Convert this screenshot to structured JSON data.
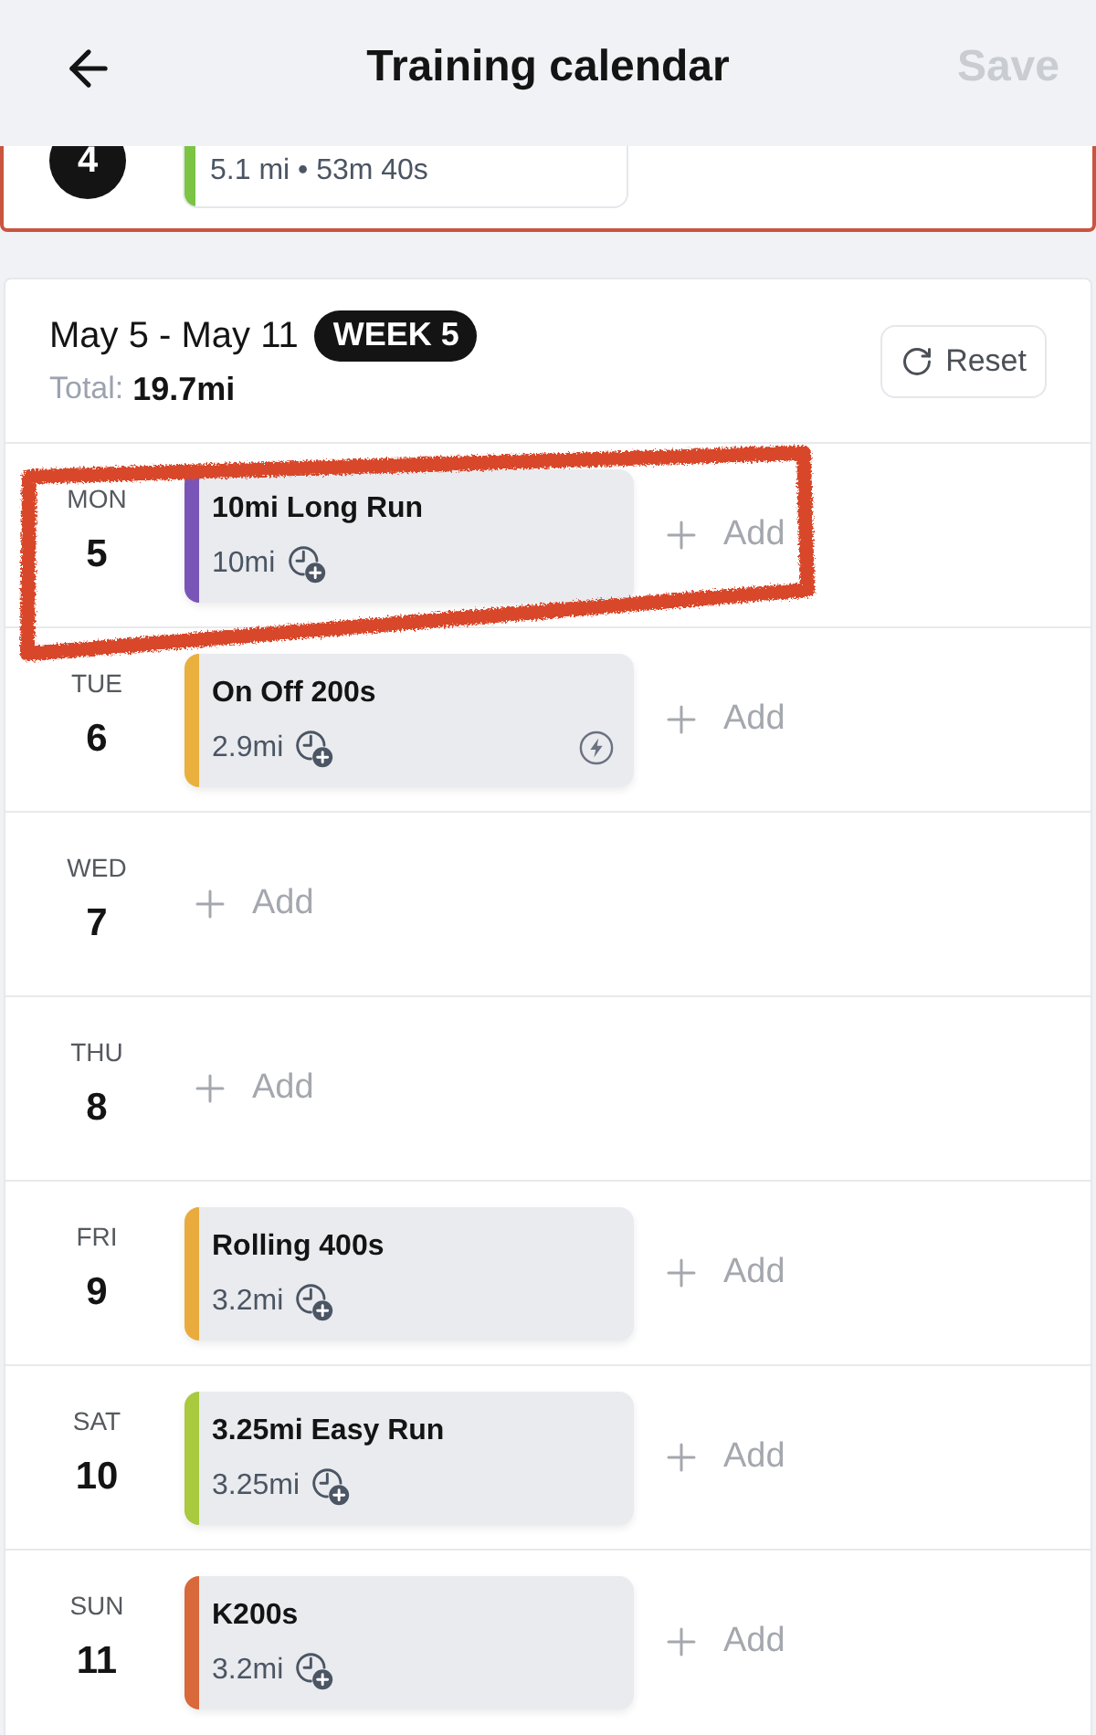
{
  "header": {
    "title": "Training calendar",
    "save": {
      "label": "Save",
      "disabled": true
    }
  },
  "previous_week": {
    "week_number": "4",
    "workout": {
      "stats": "5.1 mi • 53m 40s",
      "color": "#7cc444"
    }
  },
  "week": {
    "range": "May 5 - May 11",
    "badge": "WEEK 5",
    "total_label": "Total:",
    "total_value": "19.7mi",
    "reset": "Reset"
  },
  "days": [
    {
      "weekday": "MON",
      "date": "5",
      "highlighted": true,
      "workouts": [
        {
          "title": "10mi Long Run",
          "distance": "10mi",
          "color": "#7a55b8",
          "key_workout": false
        }
      ],
      "add_label": "Add"
    },
    {
      "weekday": "TUE",
      "date": "6",
      "highlighted": false,
      "workouts": [
        {
          "title": "On Off 200s",
          "distance": "2.9mi",
          "color": "#e9b03e",
          "key_workout": true
        }
      ],
      "add_label": "Add"
    },
    {
      "weekday": "WED",
      "date": "7",
      "highlighted": false,
      "add_label": "Add"
    },
    {
      "weekday": "THU",
      "date": "8",
      "highlighted": false,
      "add_label": "Add"
    },
    {
      "weekday": "FRI",
      "date": "9",
      "highlighted": false,
      "workouts": [
        {
          "title": "Rolling 400s",
          "distance": "3.2mi",
          "color": "#e9ab3d",
          "key_workout": false
        }
      ],
      "add_label": "Add"
    },
    {
      "weekday": "SAT",
      "date": "10",
      "highlighted": false,
      "workouts": [
        {
          "title": "3.25mi Easy Run",
          "distance": "3.25mi",
          "color": "#a9c93f",
          "key_workout": false
        }
      ],
      "add_label": "Add"
    },
    {
      "weekday": "SUN",
      "date": "11",
      "highlighted": false,
      "workouts": [
        {
          "title": "K200s",
          "distance": "3.2mi",
          "color": "#d9683a",
          "key_workout": false
        }
      ],
      "add_label": "Add"
    }
  ]
}
